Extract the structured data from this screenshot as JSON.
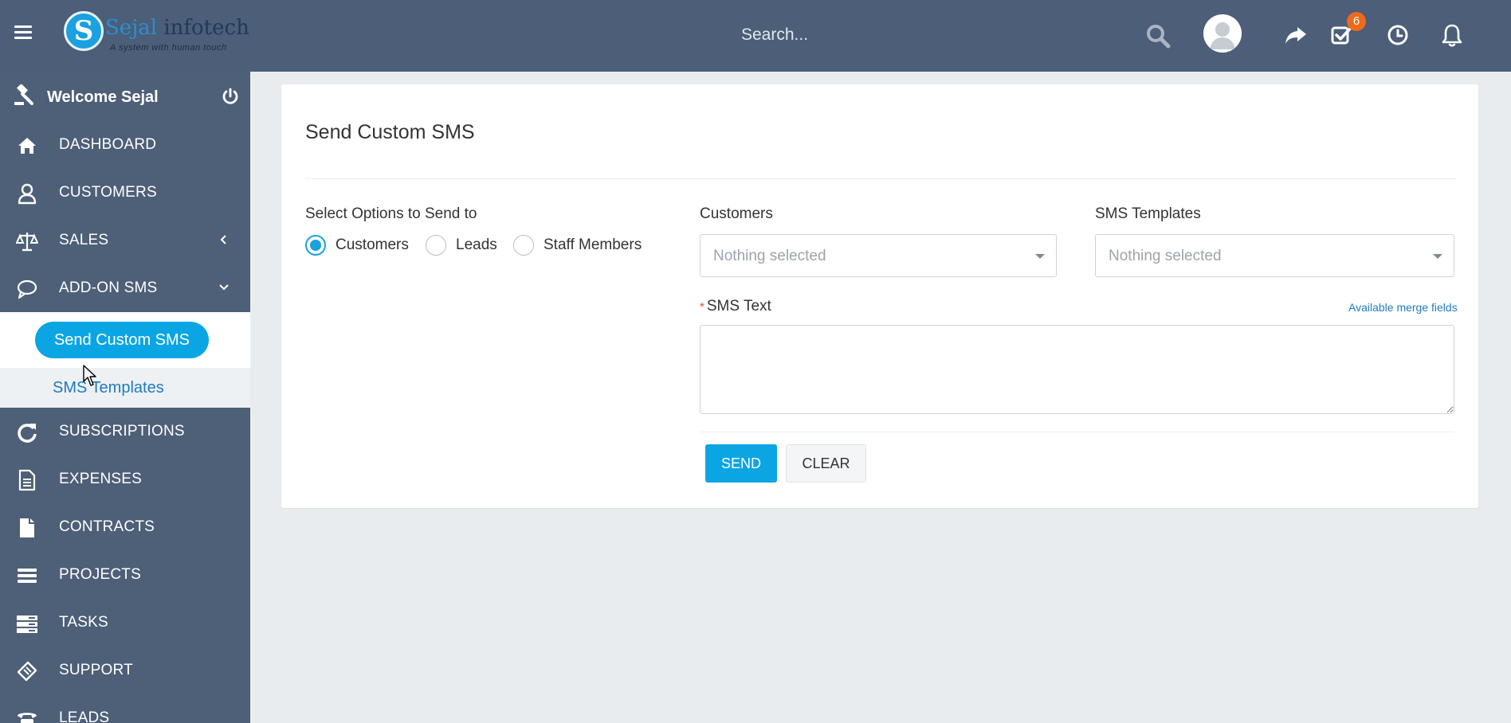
{
  "topbar": {
    "logo_letter": "S",
    "logo_name_1": "Sejal",
    "logo_name_2": " infotech",
    "logo_tagline": "A system with human touch",
    "search_placeholder": "Search...",
    "tasks_badge": "6",
    "icons": [
      "menu-icon",
      "search-icon",
      "avatar",
      "share-icon",
      "tasks-icon",
      "clock-icon",
      "bell-icon"
    ],
    "colors": {
      "bar": "#4c5e78",
      "badge": "#ee6a1b"
    }
  },
  "sidebar": {
    "welcome": "Welcome Sejal",
    "items": [
      {
        "label": "DASHBOARD",
        "icon": "home-icon"
      },
      {
        "label": "CUSTOMERS",
        "icon": "user-icon"
      },
      {
        "label": "SALES",
        "icon": "balance-scale-icon"
      },
      {
        "label": "ADD-ON SMS",
        "icon": "chat-bubble-icon"
      },
      {
        "label": "SUBSCRIPTIONS",
        "icon": "refresh-icon"
      },
      {
        "label": "EXPENSES",
        "icon": "file-text-icon"
      },
      {
        "label": "CONTRACTS",
        "icon": "file-icon"
      },
      {
        "label": "PROJECTS",
        "icon": "bars-icon"
      },
      {
        "label": "TASKS",
        "icon": "tasks-list-icon"
      },
      {
        "label": "SUPPORT",
        "icon": "ticket-icon"
      },
      {
        "label": "LEADS",
        "icon": "phone-icon"
      }
    ],
    "sub_items": [
      {
        "label": "Send Custom SMS",
        "active": true
      },
      {
        "label": "SMS Templates",
        "active": false
      }
    ],
    "colors": {
      "bg": "#4e5f78",
      "accent": "#0ba5e4"
    }
  },
  "main": {
    "title": "Send Custom SMS",
    "send_to_label": "Select Options to Send to",
    "radios": [
      {
        "label": "Customers",
        "checked": true
      },
      {
        "label": "Leads",
        "checked": false
      },
      {
        "label": "Staff Members",
        "checked": false
      }
    ],
    "customers_label": "Customers",
    "customers_value": "Nothing selected",
    "templates_label": "SMS Templates",
    "templates_value": "Nothing selected",
    "sms_text_label": "SMS Text",
    "sms_text_required": "*",
    "merge_fields_link": "Available merge fields",
    "sms_text_value": "",
    "send_button": "SEND",
    "clear_button": "CLEAR"
  }
}
